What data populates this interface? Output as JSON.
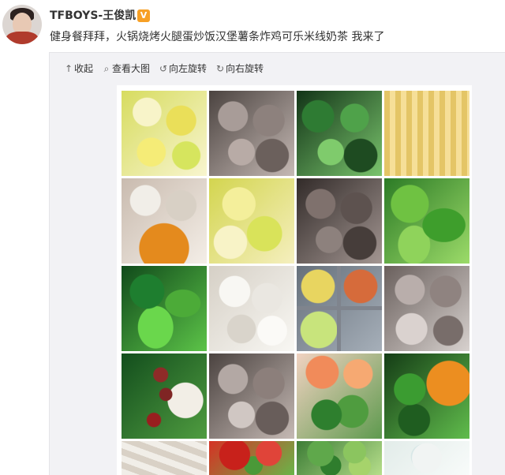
{
  "post": {
    "username": "TFBOYS-王俊凯",
    "verified_badge": "V",
    "text": "健身餐拜拜，火锅烧烤火腿蛋炒饭汉堡薯条炸鸡可乐米线奶茶 我来了"
  },
  "toolbar": {
    "collapse_label": "收起",
    "view_large_label": "查看大图",
    "rotate_left_label": "向左旋转",
    "rotate_right_label": "向右旋转"
  },
  "icons": {
    "collapse": "arrow-up-icon",
    "view_large": "magnifier-icon",
    "rotate_left": "rotate-left-icon",
    "rotate_right": "rotate-right-icon",
    "verified": "verified-badge-icon"
  },
  "colors": {
    "verified_badge": "#f7a025",
    "panel_background": "#f2f2f5"
  }
}
